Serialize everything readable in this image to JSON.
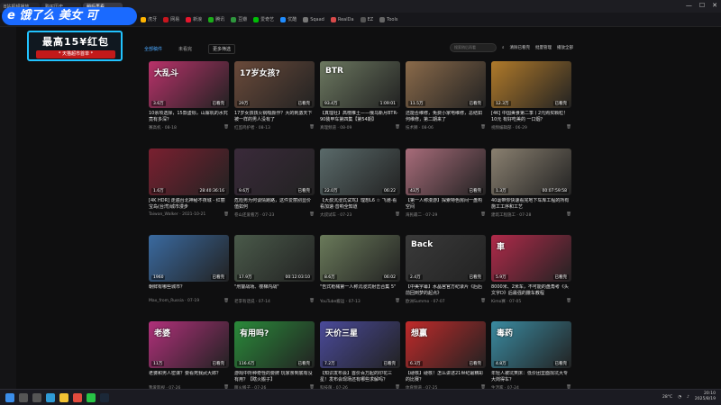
{
  "tabs": [
    {
      "label": "B站视频播放"
    },
    {
      "label": "购买历史"
    },
    {
      "label": "稍后再看"
    }
  ],
  "window_controls": [
    "—",
    "☐",
    "✕"
  ],
  "bookmarks": [
    {
      "label": "百度",
      "color": "#2f6de1"
    },
    {
      "label": "知乎",
      "color": "#0b6ef5"
    },
    {
      "label": "淘宝",
      "color": "#ff5500"
    },
    {
      "label": "京东",
      "color": "#e1251b"
    },
    {
      "label": "微博",
      "color": "#e6162d"
    },
    {
      "label": "斗鱼",
      "color": "#ff7a00"
    },
    {
      "label": "虎牙",
      "color": "#ffb400"
    },
    {
      "label": "网易",
      "color": "#c8161e"
    },
    {
      "label": "新浪",
      "color": "#e6162d"
    },
    {
      "label": "腾讯",
      "color": "#1aad19"
    },
    {
      "label": "豆瓣",
      "color": "#2e963d"
    },
    {
      "label": "爱奇艺",
      "color": "#00be06"
    },
    {
      "label": "优酷",
      "color": "#1f8cff"
    },
    {
      "label": "Sqaad",
      "color": "#777"
    },
    {
      "label": "RealDa",
      "color": "#d94a4a"
    },
    {
      "label": "EZ",
      "color": "#555"
    },
    {
      "label": "Tools",
      "color": "#666"
    }
  ],
  "ad": {
    "logo": "e 饿了么 美女 可",
    "main": "最高15¥红包",
    "sub": "* 天猫超市首单 *"
  },
  "toolbar": {
    "tabs": [
      "全部稿件",
      "未看完"
    ],
    "sort": "更多筛选",
    "search_placeholder": "搜索稍后再看",
    "actions": [
      "清除已看完",
      "批量管理",
      "播放全部"
    ]
  },
  "videos": [
    {
      "title": "10余项选择，15款虚标，山寨机的水究竟有多深？",
      "author": "赛高机",
      "date": "08-18",
      "stat": "3.6万",
      "dur": "已看完",
      "mark": "大乱斗",
      "bg": "#b8326a"
    },
    {
      "title": "17岁女孩孩火锅吸颜作？大的刺激天下被一样的男人没有了",
      "author": "红监鸣护者",
      "date": "08-13",
      "stat": "29万",
      "dur": "已看完",
      "mark": "17岁女孩?",
      "bg": "#6a4a3a"
    },
    {
      "title": "【真理社】高榜推土——俄乌新月BTR-90装甲车第四集【第54期】",
      "author": "真理频道",
      "date": "08-09",
      "stat": "93.4万",
      "dur": "1:09:01",
      "mark": "BTR",
      "bg": "#6c7860"
    },
    {
      "title": "还能否维修，免费小家电维修，总结如何维修，第二期来了",
      "author": "技术狮",
      "date": "08-06",
      "stat": "11.5万",
      "dur": "已看完",
      "mark": "",
      "bg": "#8a6a4a"
    },
    {
      "title": "[4K] 中国美食第二季丨2元购买颗粒！10元 有好吃美的 一口烟？",
      "author": "视频编辑部",
      "date": "06-29",
      "stat": "12.3万",
      "dur": "已看完",
      "mark": "",
      "bg": "#b07a2a"
    },
    {
      "title": "[4K HDR] 走遍台北神秘不夜城 - 红丽宝岛(台湾)城市漫步",
      "author": "Taiwan_Walker",
      "date": "2021-10-21",
      "stat": "1.6万",
      "dur": "28:40:36:16",
      "mark": "",
      "bg": "#7a2030"
    },
    {
      "title": "危险男为何谈情跑路，这件爱丽别显价值如何",
      "author": "卷山还爱看万",
      "date": "07-23",
      "stat": "9.6万",
      "dur": "已看完",
      "mark": "",
      "bg": "#3a2a3a"
    },
    {
      "title": "【大叔沉浸式试驾】理想L6 ☆ 飞驰·看看加速·音响全知道",
      "author": "大叔试车",
      "date": "07-23",
      "stat": "22.0万",
      "dur": "06:22",
      "mark": "",
      "bg": "#5a6a6a"
    },
    {
      "title": "【第一人称漫游】探索特色房间一盘构空间",
      "author": "海民最二",
      "date": "07-29",
      "stat": "43万",
      "dur": "已看完",
      "mark": "",
      "bg": "#a86c7a"
    },
    {
      "title": "40毫带你快速看完地下车库工程的所有施工工序和工艺",
      "author": "建筑工程施工",
      "date": "07-28",
      "stat": "1.3万",
      "dur": "00:07:59:58",
      "mark": "",
      "bg": "#8a8070"
    },
    {
      "title": "朝鲜有哪些城市？",
      "author": "Max_from_Russia",
      "date": "07-19",
      "stat": "1960",
      "dur": "已看完",
      "mark": "",
      "bg": "#3a6aa0"
    },
    {
      "title": "\"刑警战场、楼梯内战\"",
      "author": "老李有话说",
      "date": "07-14",
      "stat": "17.9万",
      "dur": "00:12:03:10",
      "mark": "",
      "bg": "#4a5a4a"
    },
    {
      "title": "\"告式枪械第一人称沉浸式射击合集 5\"",
      "author": "YouTube搬运",
      "date": "07-13",
      "stat": "8.6万",
      "dur": "06:02",
      "mark": "",
      "bg": "#6a7a5a"
    },
    {
      "title": "【中美字幕】水晶宫官方纪录片《后后前回到梦的起点》",
      "author": "欧洲Summo",
      "date": "07-07",
      "stat": "2.4万",
      "dur": "已看完",
      "mark": "Back",
      "bg": "#3a3a3a"
    },
    {
      "title": "8000米、2米车，不可能的盘角考《头文字D》后最强的撒车教程",
      "author": "Kimo赛",
      "date": "07-05",
      "stat": "5.9万",
      "dur": "已看完",
      "mark": "車",
      "bg": "#b02a4a"
    },
    {
      "title": "老婆和男人密谋？要看死我武大郎？",
      "author": "我爱影视",
      "date": "07-26",
      "stat": "11万",
      "dur": "已看完",
      "mark": "老婆",
      "bg": "#b0307a"
    },
    {
      "title": "游戏中所种奇怪的要牌 玩家亲到底有没有用？【瞎火搬子】",
      "author": "瞎火搬子",
      "date": "07-26",
      "stat": "116.6万",
      "dur": "已看完",
      "mark": "有用吗?",
      "bg": "#2a8a3a"
    },
    {
      "title": "【知识发布会】首价百万起的印花三星！发布会现场还有哪些求解吗？",
      "author": "科技菌",
      "date": "07-26",
      "stat": "7.2万",
      "dur": "已看完",
      "mark": "天价三星",
      "bg": "#4a4a9a"
    },
    {
      "title": "【硬核】硬核！怎么讲述21世纪最精彩的比赛？",
      "author": "体育频道",
      "date": "07-25",
      "stat": "6.3万",
      "dur": "已看完",
      "mark": "想赢",
      "bg": "#c02a2a"
    },
    {
      "title": "年轻人被坑笑床：低价团里面找坑大专大岗得车？",
      "author": "生活家",
      "date": "07-24",
      "stat": "4.8万",
      "dur": "已看完",
      "mark": "毒药",
      "bg": "#3a8aa0"
    }
  ],
  "taskbar": {
    "icons": [
      {
        "name": "windows-icon",
        "color": "#3b8eea"
      },
      {
        "name": "search-icon",
        "color": "#555"
      },
      {
        "name": "taskview-icon",
        "color": "#555"
      },
      {
        "name": "edge-icon",
        "color": "#2f9bd6"
      },
      {
        "name": "explorer-icon",
        "color": "#f2c233"
      },
      {
        "name": "chrome-icon",
        "color": "#e24b3d"
      },
      {
        "name": "wechat-icon",
        "color": "#28c445"
      },
      {
        "name": "steam-icon",
        "color": "#1b2838"
      }
    ],
    "weather": "28°C",
    "time": "20:10",
    "date": "2025/8/19"
  }
}
